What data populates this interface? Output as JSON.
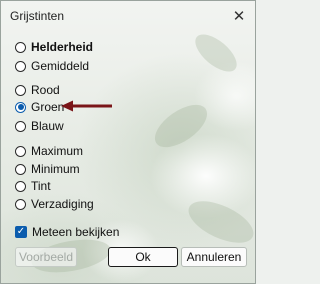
{
  "window": {
    "title": "Grijstinten",
    "close_glyph": "✕"
  },
  "options_group1": [
    {
      "label": "Helderheid",
      "selected": false,
      "bold": true
    },
    {
      "label": "Gemiddeld",
      "selected": false,
      "bold": false
    }
  ],
  "options_group2": [
    {
      "label": "Rood",
      "selected": false
    },
    {
      "label": "Groen",
      "selected": true
    },
    {
      "label": "Blauw",
      "selected": false
    }
  ],
  "options_group3": [
    {
      "label": "Maximum",
      "selected": false
    },
    {
      "label": "Minimum",
      "selected": false
    },
    {
      "label": "Tint",
      "selected": false
    },
    {
      "label": "Verzadiging",
      "selected": false
    }
  ],
  "preview_checkbox": {
    "label": "Meteen bekijken",
    "checked": true,
    "check_glyph": "✓"
  },
  "buttons": {
    "preview_label": "Voorbeeld",
    "ok_label": "Ok",
    "cancel_label": "Annuleren"
  },
  "annotation_arrow_color": "#7a1518",
  "accent_color": "#0b5cad"
}
